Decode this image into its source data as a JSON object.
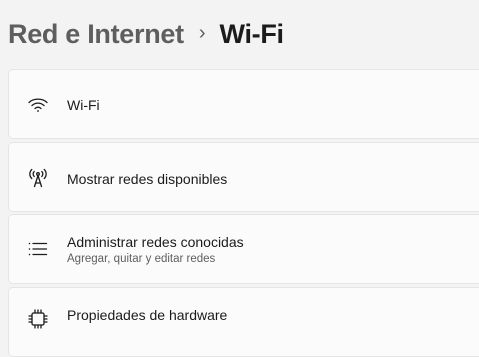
{
  "breadcrumb": {
    "parent": "Red e Internet",
    "separator": "›",
    "current": "Wi-Fi"
  },
  "settings": [
    {
      "label": "Wi-Fi",
      "icon": "wifi-icon"
    },
    {
      "label": "Mostrar redes disponibles",
      "icon": "antenna-icon"
    },
    {
      "label": "Administrar redes conocidas",
      "sublabel": "Agregar, quitar y editar redes",
      "icon": "list-icon"
    },
    {
      "label": "Propiedades de hardware",
      "icon": "chip-icon"
    }
  ]
}
